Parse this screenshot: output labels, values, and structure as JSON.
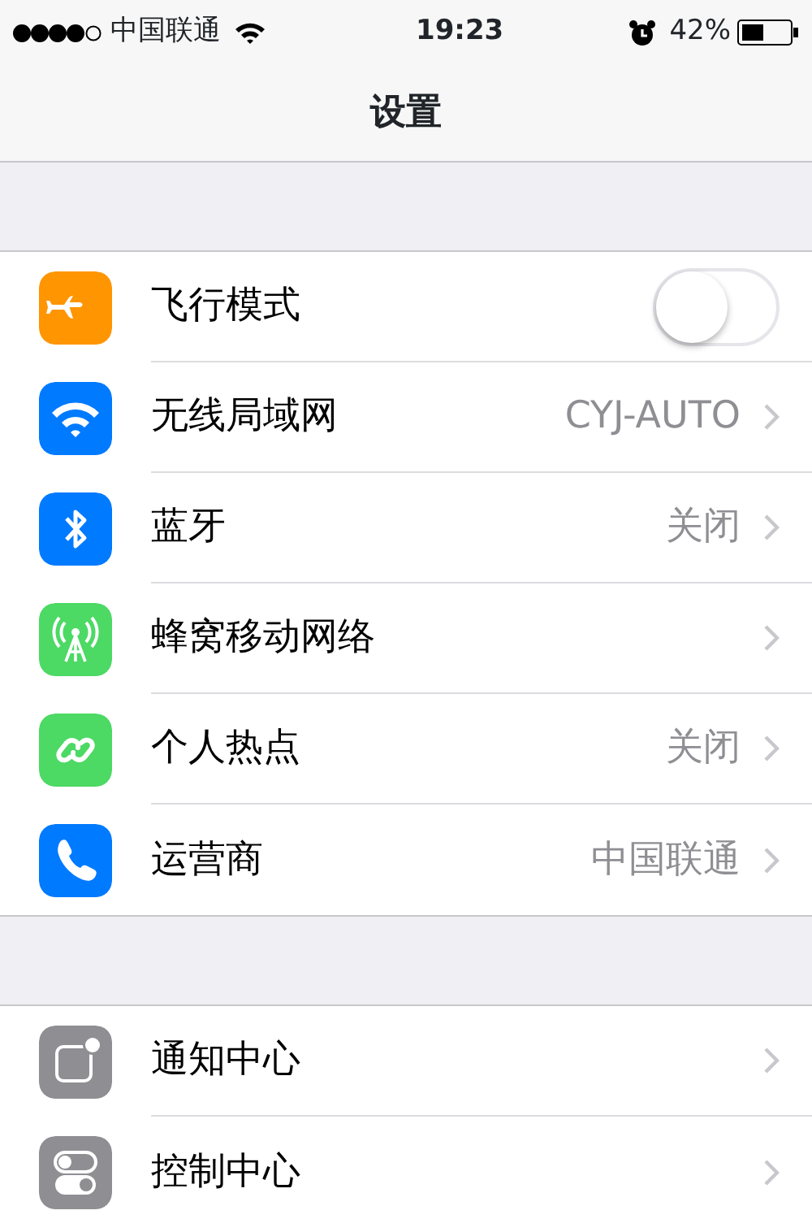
{
  "status_bar": {
    "carrier": "中国联通",
    "time": "19:23",
    "battery": "42%"
  },
  "nav_bar": {
    "title": "设置"
  },
  "groups": [
    {
      "rows": [
        {
          "kind": "toggle",
          "label": "飞行模式",
          "on": false
        },
        {
          "kind": "link",
          "label": "无线局域网",
          "value": "CYJ-AUTO"
        },
        {
          "kind": "link",
          "label": "蓝牙",
          "value": "关闭"
        },
        {
          "kind": "link",
          "label": "蜂窝移动网络"
        },
        {
          "kind": "link",
          "label": "个人热点",
          "value": "关闭"
        },
        {
          "kind": "link",
          "label": "运营商",
          "value": "中国联通"
        }
      ]
    },
    {
      "rows": [
        {
          "kind": "link",
          "label": "通知中心"
        },
        {
          "kind": "link",
          "label": "控制中心"
        }
      ]
    }
  ]
}
